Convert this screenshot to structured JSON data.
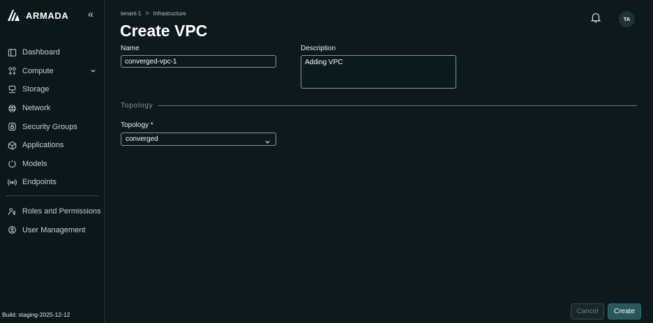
{
  "brand": {
    "name": "ARMADA"
  },
  "sidebar": {
    "collapse_glyph": "«",
    "items": [
      {
        "label": "Dashboard",
        "icon": "dashboard-icon"
      },
      {
        "label": "Compute",
        "icon": "compute-icon",
        "expandable": true
      },
      {
        "label": "Storage",
        "icon": "storage-icon"
      },
      {
        "label": "Network",
        "icon": "network-icon"
      },
      {
        "label": "Security Groups",
        "icon": "security-icon"
      },
      {
        "label": "Applications",
        "icon": "applications-icon"
      },
      {
        "label": "Models",
        "icon": "models-icon"
      },
      {
        "label": "Endpoints",
        "icon": "endpoints-icon"
      }
    ],
    "admin_items": [
      {
        "label": "Roles and Permissions",
        "icon": "roles-icon"
      },
      {
        "label": "User Management",
        "icon": "user-management-icon"
      }
    ],
    "build": "Build: staging-2025-12-12"
  },
  "header": {
    "breadcrumb": [
      "tenant-1",
      "Infrastructure"
    ],
    "breadcrumb_sep": ">",
    "title": "Create VPC",
    "avatar_initials": "TA"
  },
  "form": {
    "name_label": "Name",
    "name_value": "converged-vpc-1",
    "description_label": "Description",
    "description_value": "Adding VPC",
    "section_title": "Topology",
    "topology_label": "Topology *",
    "topology_value": "converged"
  },
  "actions": {
    "cancel": "Cancel",
    "create": "Create"
  },
  "colors": {
    "background": "#0c1a1f",
    "sidebar": "#0a171b",
    "primary_button": "#24585a"
  }
}
